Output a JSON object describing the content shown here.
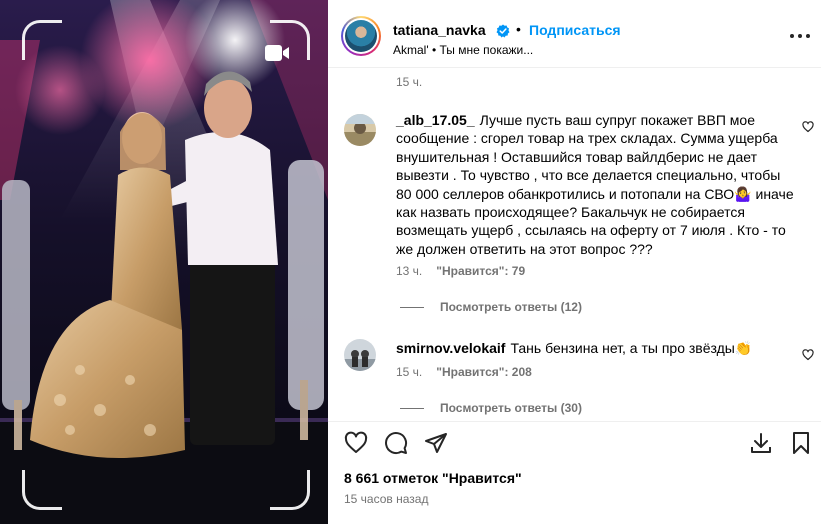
{
  "media": {
    "reel_icon": "reel-camera-icon"
  },
  "header": {
    "username": "tatiana_navka",
    "separator": "•",
    "follow_label": "Подписаться",
    "audio": "Akmal' • Ты мне покажи..."
  },
  "comments": {
    "top_timestamp": "15 ч.",
    "items": [
      {
        "author": "_alb_17.05_",
        "text": "Лучше пусть ваш супруг покажет ВВП мое сообщение : сгорел товар на трех складах. Сумма ущерба внушительная ! Оставшийся товар вайлдберис не дает вывезти . То чувство , что все делается специально, чтобы 80 000 селлеров обанкротились и потопали на СВО🤷‍♀️ иначе как назвать происходящее? Бакальчук не собирается возмещать ущерб , ссылаясь на оферту от 7 июля . Кто - то же должен ответить на этот вопрос ???",
        "time": "13 ч.",
        "likes": "\"Нравится\": 79",
        "replies": "Посмотреть ответы (12)"
      },
      {
        "author": "smirnov.velokaif",
        "text": "Тань бензина нет, а ты про звёзды👏",
        "time": "15 ч.",
        "likes": "\"Нравится\": 208",
        "replies": "Посмотреть ответы (30)"
      }
    ]
  },
  "footer": {
    "likes_total": "8 661 отметок \"Нравится\"",
    "posted": "15 часов назад"
  },
  "colors": {
    "accent": "#0095f6",
    "secondary_text": "#737373",
    "divider": "#efefef"
  }
}
